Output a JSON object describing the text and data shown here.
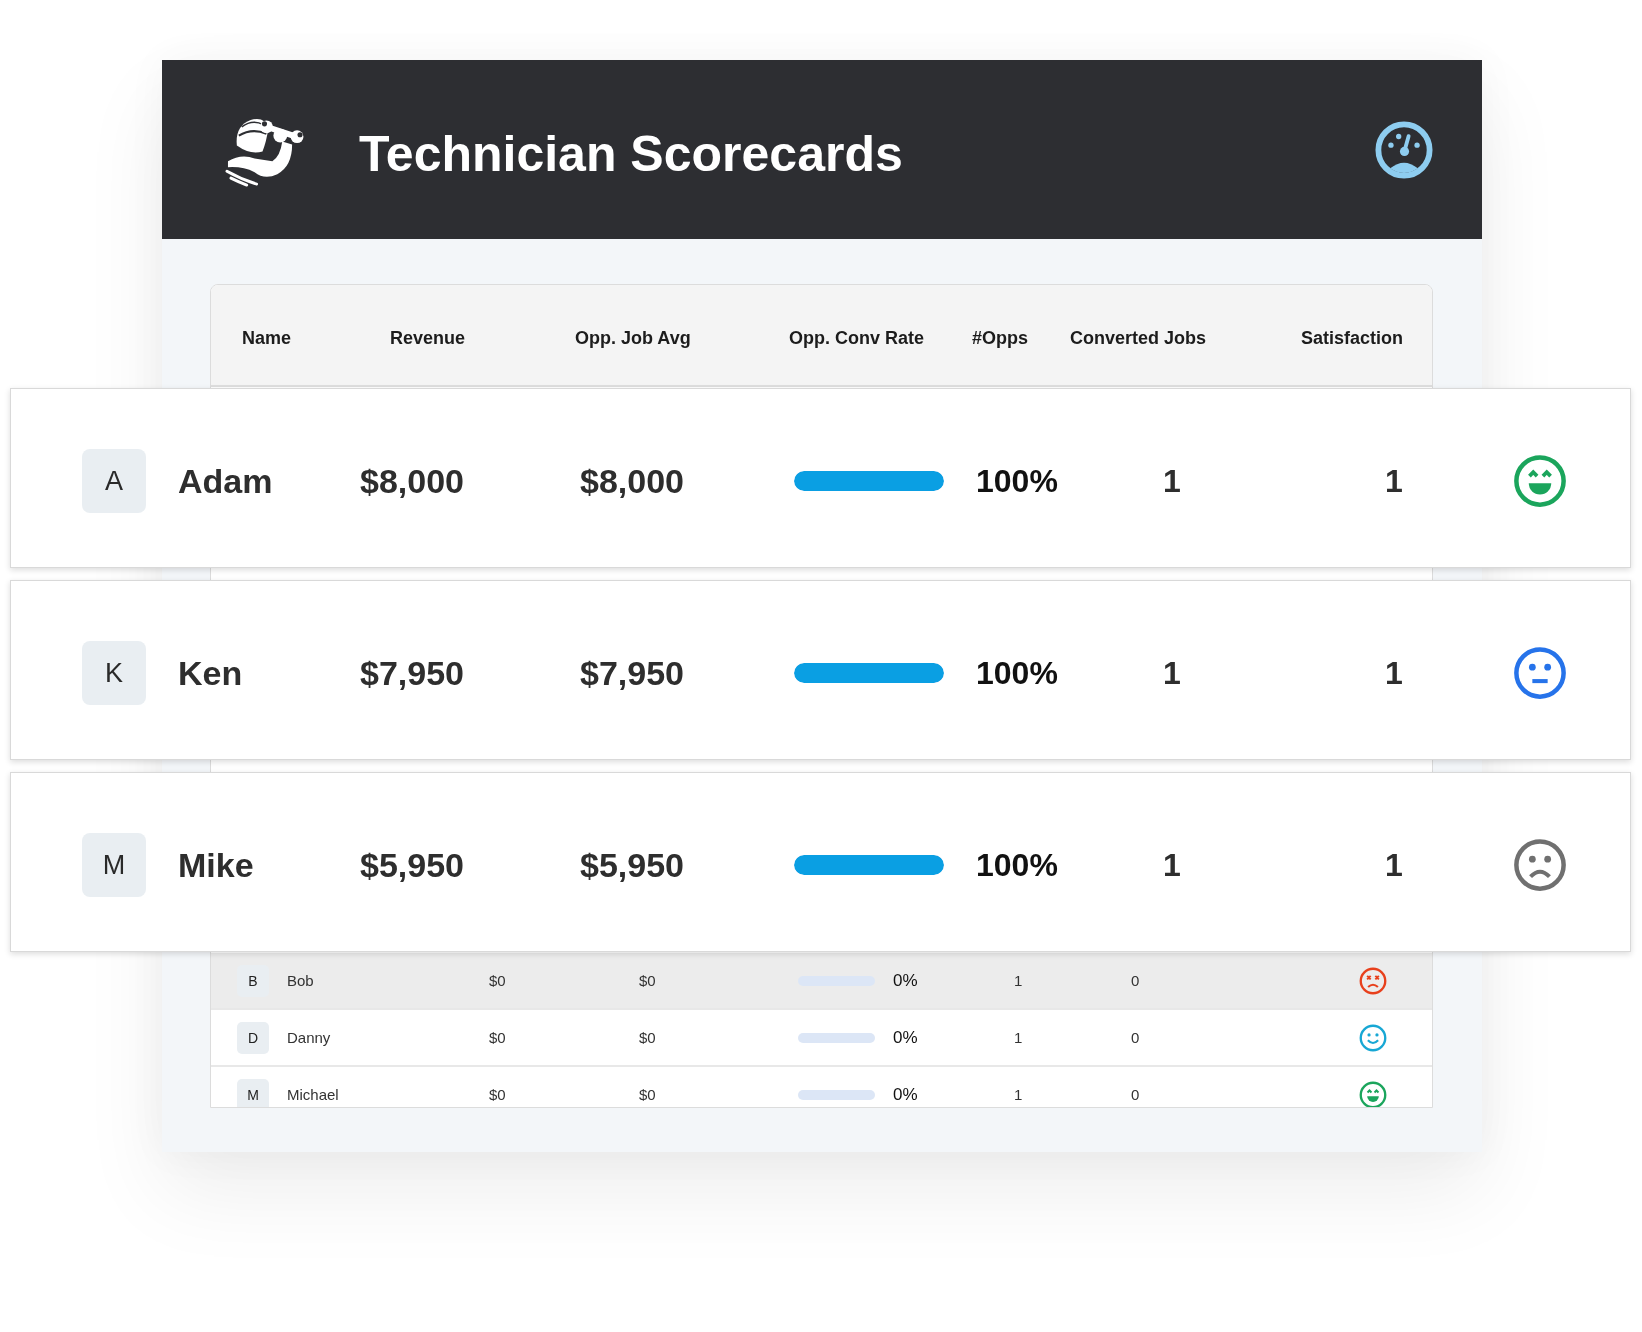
{
  "header": {
    "title": "Technician Scorecards"
  },
  "table": {
    "columns": [
      "Name",
      "Revenue",
      "Opp. Job Avg",
      "Opp. Conv Rate",
      "#Opps",
      "Converted Jobs",
      "Satisfaction"
    ],
    "rows": [
      {
        "initial": "B",
        "name": "Bob",
        "revenue": "$0",
        "job_avg": "$0",
        "conv_rate": {
          "level": 0,
          "reading": "0%"
        },
        "opps": "1",
        "converted_jobs": "0",
        "satisfaction": {
          "kind": "dizzy",
          "color": "#e8401c"
        },
        "selected": true
      },
      {
        "initial": "D",
        "name": "Danny",
        "revenue": "$0",
        "job_avg": "$0",
        "conv_rate": {
          "level": 0,
          "reading": "0%"
        },
        "opps": "1",
        "converted_jobs": "0",
        "satisfaction": {
          "kind": "smile",
          "color": "#17a7d4"
        },
        "selected": false
      },
      {
        "initial": "M",
        "name": "Michael",
        "revenue": "$0",
        "job_avg": "$0",
        "conv_rate": {
          "level": 0,
          "reading": "0%"
        },
        "opps": "1",
        "converted_jobs": "0",
        "satisfaction": {
          "kind": "grin",
          "color": "#1ba55c"
        },
        "selected": false
      }
    ]
  },
  "highlight_cards": [
    {
      "initial": "A",
      "name": "Adam",
      "revenue": "$8,000",
      "job_avg": "$8,000",
      "conv_rate": {
        "level": 1,
        "reading": "100%"
      },
      "opps": "1",
      "converted_jobs": "1",
      "satisfaction": {
        "kind": "grin",
        "color": "#1ba55c"
      }
    },
    {
      "initial": "K",
      "name": "Ken",
      "revenue": "$7,950",
      "job_avg": "$7,950",
      "conv_rate": {
        "level": 1,
        "reading": "100%"
      },
      "opps": "1",
      "converted_jobs": "1",
      "satisfaction": {
        "kind": "neutral",
        "color": "#2673ea"
      }
    },
    {
      "initial": "M",
      "name": "Mike",
      "revenue": "$5,950",
      "job_avg": "$5,950",
      "conv_rate": {
        "level": 1,
        "reading": "100%"
      },
      "opps": "1",
      "converted_jobs": "1",
      "satisfaction": {
        "kind": "sad",
        "color": "#707070"
      }
    }
  ]
}
